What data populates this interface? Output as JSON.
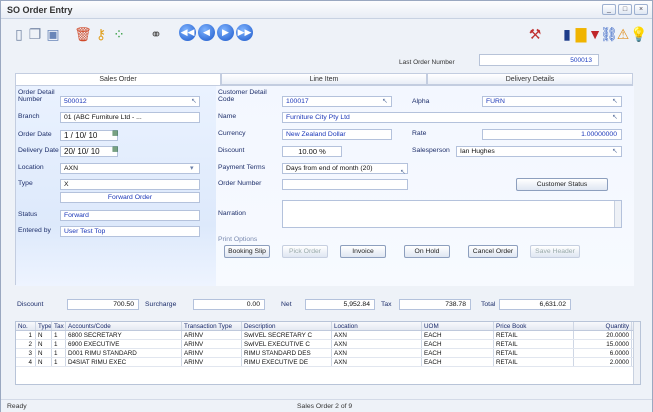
{
  "window": {
    "title": "SO Order Entry"
  },
  "toolbar": {
    "nav": [
      "◀◀",
      "◀",
      "▶",
      "▶▶"
    ]
  },
  "last_order": {
    "label": "Last Order Number",
    "value": "500013"
  },
  "tabs": [
    "Sales Order",
    "Line Item",
    "Delivery Details"
  ],
  "left": {
    "section_label": "Order Detail",
    "number_label": "Number",
    "number": "500012",
    "branch_label": "Branch",
    "branch": "01  (ABC Furniture Ltd - ...",
    "order_date_label": "Order Date",
    "order_date": "1 / 10/ 10",
    "delivery_date_label": "Delivery Date",
    "delivery_date": "20/ 10/ 10",
    "location_label": "Location",
    "location": "AXN",
    "type_label": "Type",
    "type": "X",
    "type_desc": "Forward Order",
    "status_label": "Status",
    "status": "Forward",
    "entered_label": "Entered by",
    "entered": "User Test Top"
  },
  "right": {
    "section_label": "Customer Detail",
    "code_label": "Code",
    "code": "100017",
    "alpha_label": "Alpha",
    "alpha": "FURN",
    "name_label": "Name",
    "name": "Furniture City Pty Ltd",
    "currency_label": "Currency",
    "currency": "New Zealand Dollar",
    "rate_label": "Rate",
    "rate": "1.00000000",
    "discount_label": "Discount",
    "discount": "10.00 %",
    "salesperson_label": "Salesperson",
    "salesperson": "Ian Hughes",
    "payment_label": "Payment Terms",
    "payment": "Days from end of month (20)",
    "order_number_label": "Order Number",
    "order_number": "",
    "narration_label": "Narration",
    "customer_status_btn": "Customer Status",
    "print_options_label": "Print Options",
    "buttons": [
      "Booking Slip",
      "Pick Order",
      "Invoice",
      "On Hold",
      "Cancel Order",
      "Save Header"
    ]
  },
  "totals": {
    "discount_label": "Discount",
    "discount": "700.50",
    "surcharge_label": "Surcharge",
    "surcharge": "0.00",
    "net_label": "Net",
    "net": "5,952.84",
    "tax_label": "Tax",
    "tax": "738.78",
    "total_label": "Total",
    "total": "6,631.02"
  },
  "grid": {
    "headers": [
      "No.",
      "Type",
      "Tax",
      "Accounts/Code",
      "Transaction Type",
      "Description",
      "Location",
      "UOM",
      "Price Book",
      "Quantity"
    ],
    "rows": [
      [
        "1",
        "N",
        "1",
        "6800 SECRETARY",
        "ARINV",
        "SwIVEL SECRETARY C",
        "AXN",
        "EACH",
        "RETAIL",
        "20.0000"
      ],
      [
        "2",
        "N",
        "1",
        "6900 EXECUTIVE",
        "ARINV",
        "SwIVEL EXECUTIVE C",
        "AXN",
        "EACH",
        "RETAIL",
        "15.0000"
      ],
      [
        "3",
        "N",
        "1",
        "D001 RIMU STANDARD",
        "ARINV",
        "RIMU STANDARD DES",
        "AXN",
        "EACH",
        "RETAIL",
        "6.0000"
      ],
      [
        "4",
        "N",
        "1",
        "D4SIAT RIMU EXEC",
        "ARINV",
        "RIMU EXECUTIVE DE",
        "AXN",
        "EACH",
        "RETAIL",
        "2.0000"
      ]
    ]
  },
  "status": {
    "left": "Ready",
    "center": "Sales Order 2 of 9"
  }
}
